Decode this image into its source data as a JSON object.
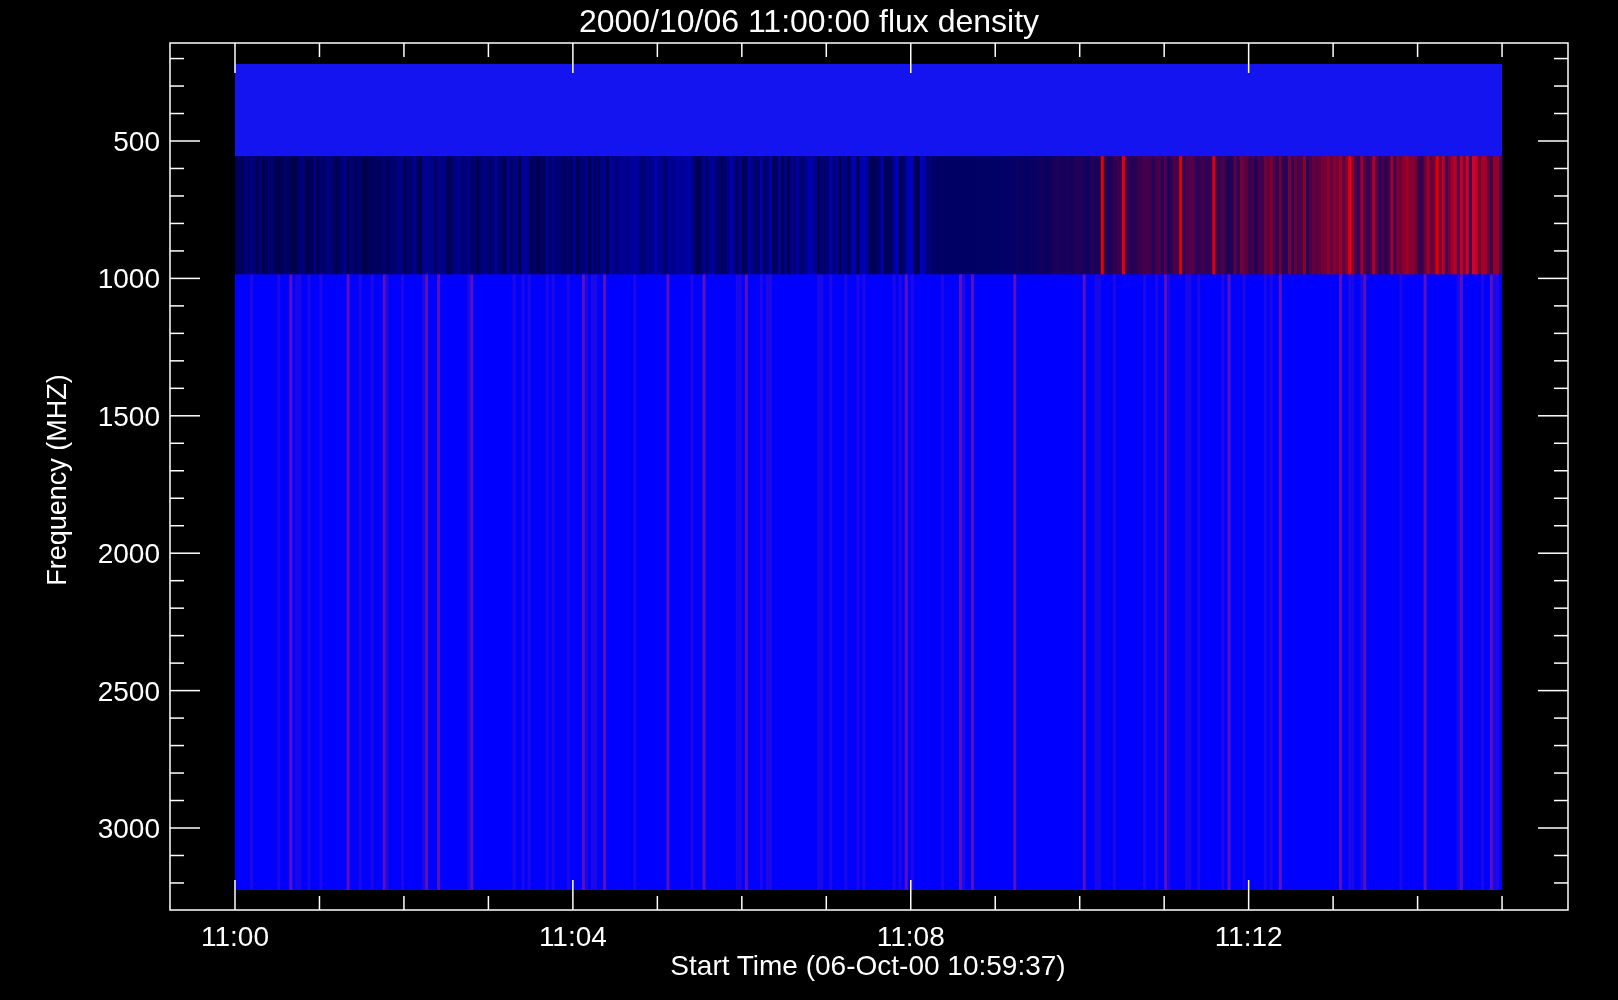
{
  "plot": {
    "title": "2000/10/06 11:00:00 flux density",
    "y_axis": {
      "label": "Frequency (MHZ)",
      "ticks": [
        "500",
        "1000",
        "1500",
        "2000",
        "2500",
        "3000"
      ]
    },
    "x_axis": {
      "label": "Start Time (06-Oct-00 10:59:37)",
      "ticks": [
        "11:00",
        "11:04",
        "11:08",
        "11:12"
      ]
    }
  }
}
